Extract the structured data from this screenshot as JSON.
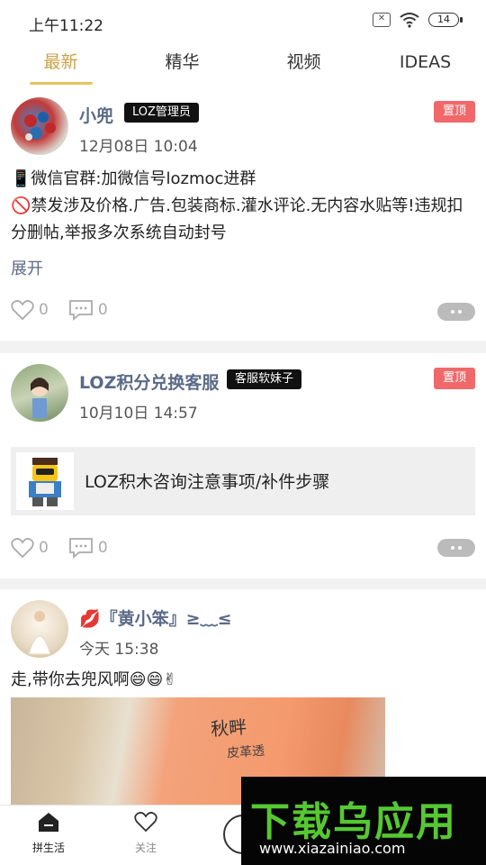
{
  "status_bar": {
    "time": "上午11:22",
    "battery": "14"
  },
  "tabs": [
    {
      "label": "最新",
      "active": true
    },
    {
      "label": "精华",
      "active": false
    },
    {
      "label": "视频",
      "active": false
    },
    {
      "label": "IDEAS",
      "active": false
    }
  ],
  "posts": [
    {
      "username": "小兜",
      "role": "LOZ管理员",
      "pin": "置顶",
      "time": "12月08日 10:04",
      "text": "📱微信官群:加微信号lozmoc进群\n🚫禁发涉及价格.广告.包装商标.灌水评论.无内容水贴等!违规扣分删帖,举报多次系统自动封号",
      "expand": "展开",
      "likes": "0",
      "comments": "0"
    },
    {
      "username": "LOZ积分兑换客服",
      "role": "客服软妹子",
      "pin": "置顶",
      "time": "10月10日 14:57",
      "link_title": "LOZ积木咨询注意事项/补件步骤",
      "likes": "0",
      "comments": "0"
    },
    {
      "username": "💋『黄小笨』≥﹏≤",
      "time": "今天 15:38",
      "text": "走,带你去兜风啊😄😄✌",
      "photo_text_1": "秋畔",
      "photo_text_2": "皮革透"
    }
  ],
  "bottom_nav": [
    {
      "label": "拼生活",
      "icon": "home-icon"
    },
    {
      "label": "关注",
      "icon": "heart-icon"
    }
  ],
  "watermark": {
    "title": "下载乌应用",
    "url": "www.xiazainiao.com"
  },
  "colors": {
    "accent": "#e8c25e",
    "pin": "#f0686a",
    "username": "#5a6a86",
    "watermark_green": "#55c832"
  }
}
